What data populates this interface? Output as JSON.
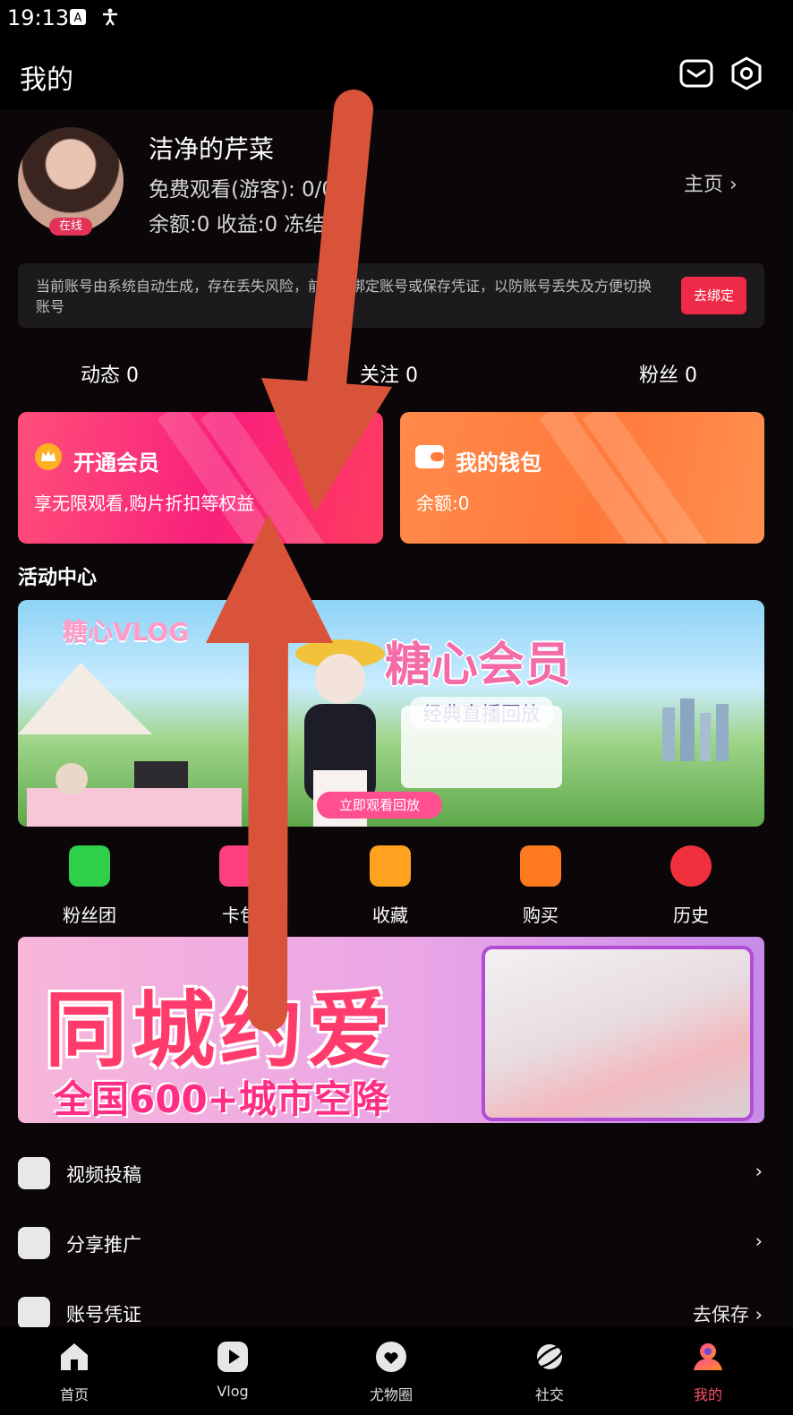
{
  "status_bar": {
    "time": "19:13"
  },
  "header": {
    "title": "我的",
    "mail_icon": "mail-icon",
    "settings_icon": "settings-icon"
  },
  "profile": {
    "name": "洁净的芹菜",
    "free_watch": "免费观看(游客): 0/0",
    "balance_line": "余额:0 收益:0 冻结:",
    "online_badge": "在线",
    "homepage_link": "主页 ›"
  },
  "notice": {
    "text": "当前账号由系统自动生成，存在丢失风险，前请先绑定账号或保存凭证，以防账号丢失及方便切换账号",
    "bind_button": "去绑定"
  },
  "stats": [
    {
      "label": "动态 0"
    },
    {
      "label": "关注 0"
    },
    {
      "label": "粉丝 0"
    }
  ],
  "cards": {
    "vip": {
      "title": "开通会员",
      "subtitle": "享无限观看,购片折扣等权益"
    },
    "wallet": {
      "title": "我的钱包",
      "subtitle": "余额:0"
    }
  },
  "activity": {
    "section_title": "活动中心",
    "banner_logo": "糖心VLOG",
    "banner_title": "糖心会员",
    "banner_subtitle": "经典直播回放",
    "banner_button": "立即观看回放"
  },
  "quick_actions": [
    {
      "label": "粉丝团",
      "icon": "fan-club-icon",
      "color": "#2fcf4a"
    },
    {
      "label": "卡包",
      "icon": "card-wallet-icon",
      "color": "#ff3f7f"
    },
    {
      "label": "收藏",
      "icon": "favorite-icon",
      "color": "#ffa21f"
    },
    {
      "label": "购买",
      "icon": "shopping-bag-icon",
      "color": "#ff7a1f"
    },
    {
      "label": "历史",
      "icon": "history-clock-icon",
      "color": "#f0313d"
    }
  ],
  "ad": {
    "title": "同城约爱",
    "subtitle": "全国600+城市空降"
  },
  "menu": [
    {
      "label": "视频投稿",
      "icon": "upload-icon",
      "right": "›"
    },
    {
      "label": "分享推广",
      "icon": "share-icon",
      "right": "›"
    },
    {
      "label": "账号凭证",
      "icon": "shield-icon",
      "right": "去保存 ›"
    }
  ],
  "bottom_nav": [
    {
      "label": "首页",
      "icon": "home-icon",
      "active": false
    },
    {
      "label": "Vlog",
      "icon": "play-icon",
      "active": false
    },
    {
      "label": "尤物圈",
      "icon": "heart-circle-icon",
      "active": false
    },
    {
      "label": "社交",
      "icon": "planet-icon",
      "active": false
    },
    {
      "label": "我的",
      "icon": "profile-icon",
      "active": true
    }
  ],
  "colors": {
    "accent": "#ef2a48",
    "overlay_arrow": "#d9533a",
    "vip_card": "#f8207b",
    "wallet_card": "#ff7a3b"
  }
}
